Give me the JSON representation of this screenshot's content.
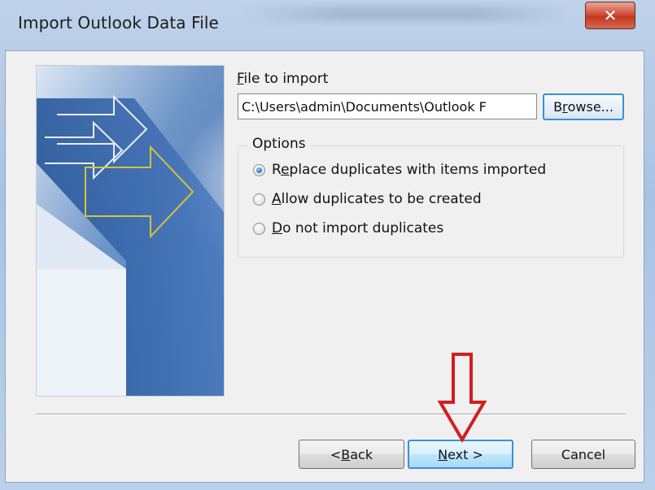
{
  "window": {
    "title": "Import Outlook Data File",
    "close_glyph": "✕"
  },
  "file": {
    "label_accel": "F",
    "label_rest": "ile to import",
    "path_value": "C:\\Users\\admin\\Documents\\Outlook F",
    "browse_accel": "r",
    "browse_pre": "B",
    "browse_post": "owse..."
  },
  "options": {
    "legend": "Options",
    "items": [
      {
        "pre": "R",
        "accel": "e",
        "post": "place duplicates with items imported",
        "checked": true
      },
      {
        "pre": "",
        "accel": "A",
        "post": "llow duplicates to be created",
        "checked": false
      },
      {
        "pre": "",
        "accel": "D",
        "post": "o not import duplicates",
        "checked": false
      }
    ]
  },
  "buttons": {
    "back_pre": "< ",
    "back_accel": "B",
    "back_post": "ack",
    "next_accel": "N",
    "next_post": "ext >",
    "cancel": "Cancel"
  },
  "colors": {
    "annotation_arrow": "#d11f1f",
    "default_button_border": "#3c8fd6",
    "close_button": "#c3371f"
  },
  "icons": {
    "close": "close-icon",
    "annotation": "down-arrow-annotation-icon"
  }
}
